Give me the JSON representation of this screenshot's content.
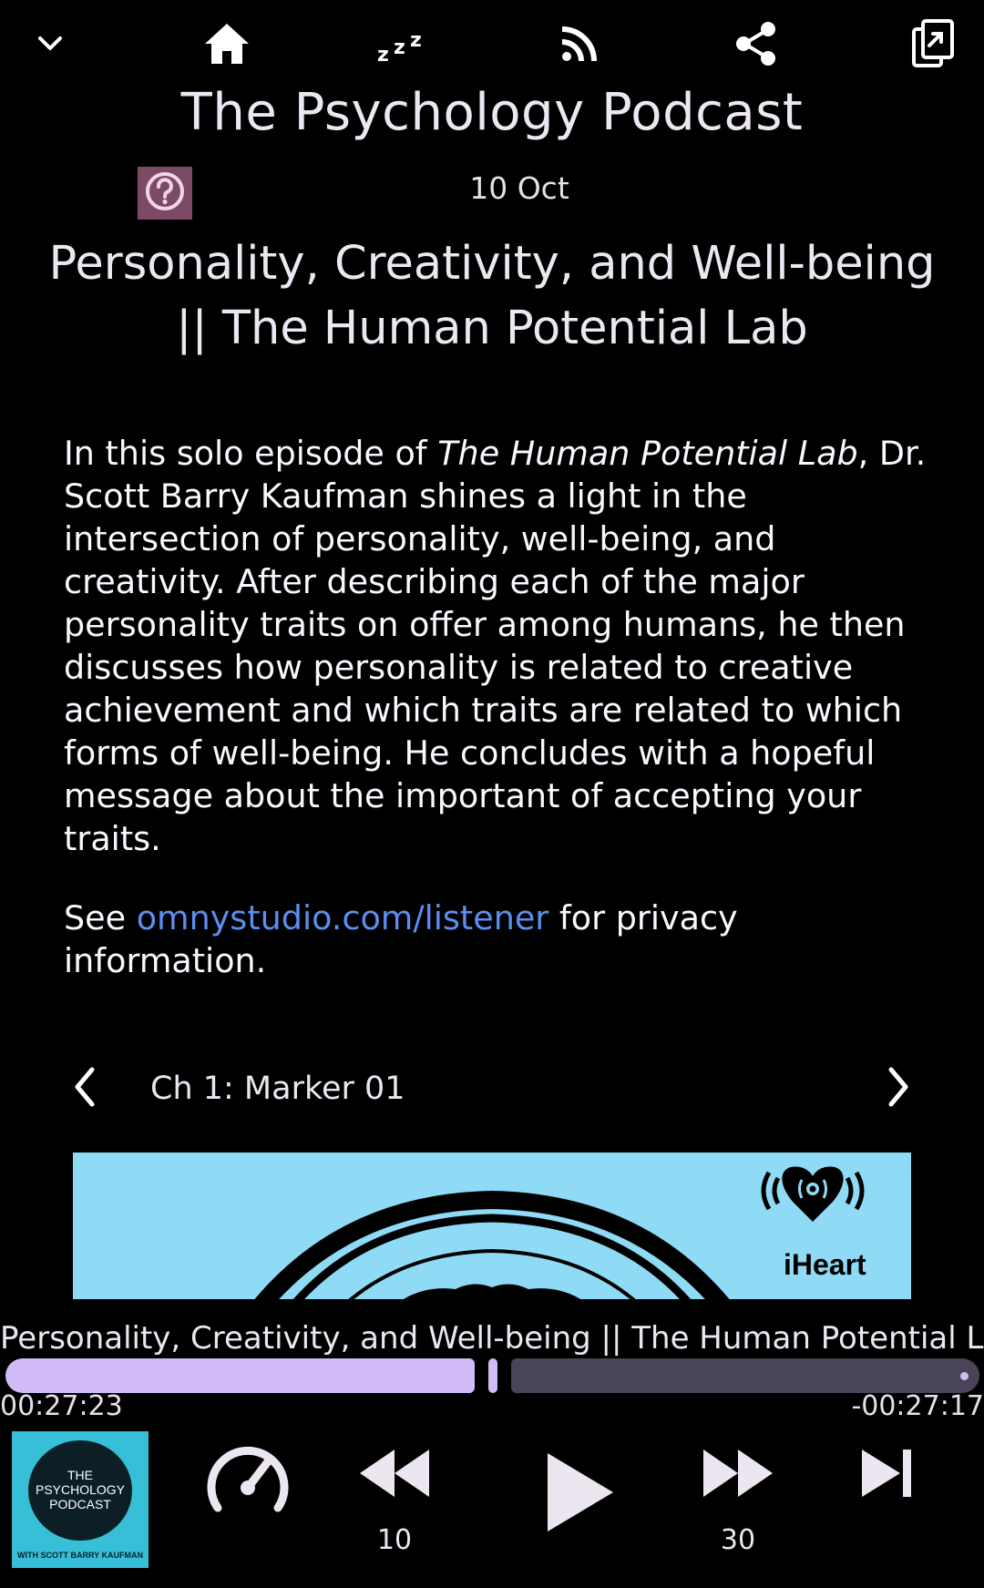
{
  "toolbar": {
    "icons": [
      "chevron-down-icon",
      "home-icon",
      "sleep-timer-icon",
      "rss-feed-icon",
      "share-icon",
      "copy-icon"
    ]
  },
  "podcast": {
    "title": "The Psychology Podcast"
  },
  "episode": {
    "date": "10 Oct",
    "title": "Personality, Creativity, and Well-being || The Human Potential Lab",
    "description": {
      "part1": "In this solo episode of ",
      "italic": "The Human Potential Lab",
      "part2": ", Dr. Scott Barry Kaufman shines a light in the intersection of personality, well-being, and creativity. After describing each of the major personality traits on offer among humans, he then discusses how personality is related to creative achievement and which traits are related to which forms of well-being. He concludes with a hopeful message about the important of accepting your traits.",
      "privacy_prefix": "See ",
      "privacy_link": "omnystudio.com/listener",
      "privacy_suffix": " for privacy information."
    }
  },
  "chapter": {
    "label": "Ch 1: Marker 01"
  },
  "artwork": {
    "brand": "iHeart"
  },
  "player": {
    "now_playing_title": "Personality, Creativity, and Well-being || The Human Potential Lab",
    "time_elapsed": "00:27:23",
    "time_remaining": "-00:27:17",
    "progress_fraction": 0.5,
    "rewind_seconds": "10",
    "forward_seconds": "30",
    "thumbnail": {
      "line1": "THE",
      "line2": "PSYCHOLOGY",
      "line3": "PODCAST",
      "line4": "WITH SCOTT BARRY KAUFMAN"
    }
  },
  "colors": {
    "background": "#000000",
    "accent": "#d2bcf7",
    "track": "#4a4458",
    "link": "#5a8ff0",
    "help_bg": "#7c4a64",
    "artwork_bg": "#8fdaf5"
  }
}
